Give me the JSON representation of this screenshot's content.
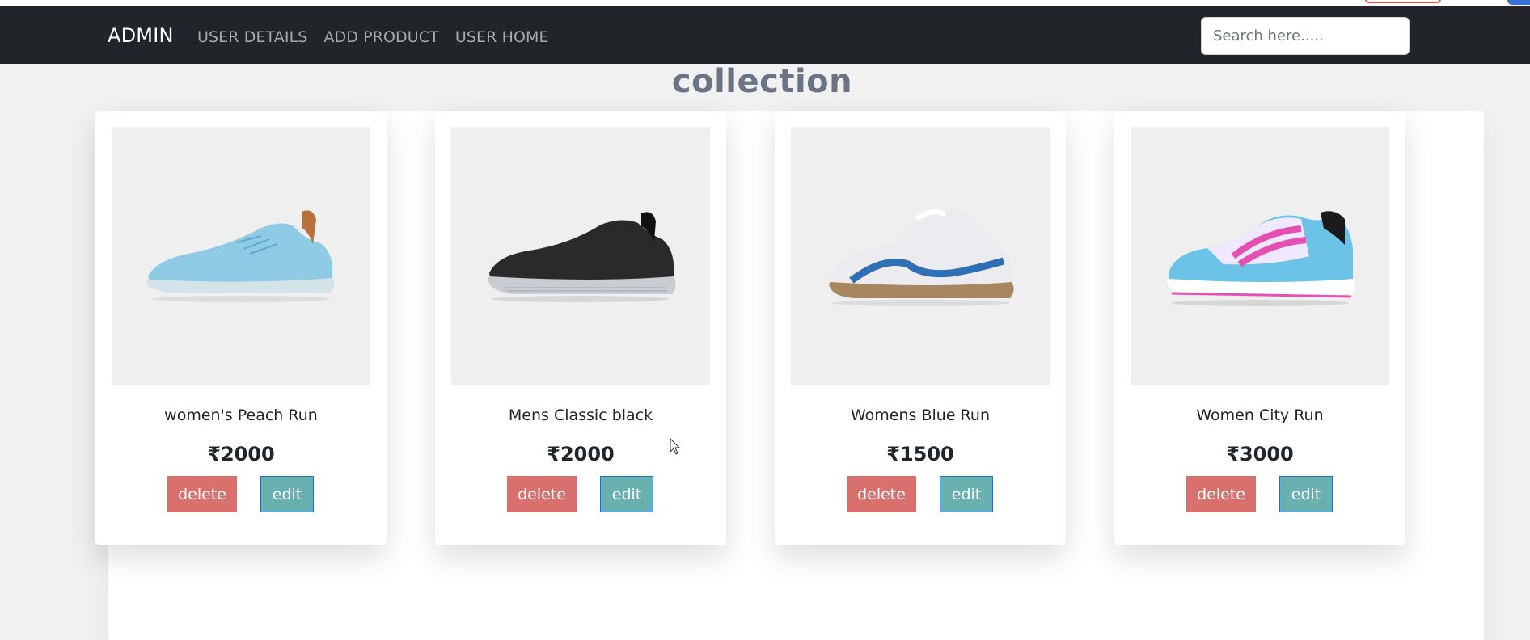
{
  "nav": {
    "brand": "ADMIN",
    "links": [
      "USER DETAILS",
      "ADD PRODUCT",
      "USER HOME"
    ],
    "search_placeholder": "Search here....."
  },
  "page": {
    "heading": "collection"
  },
  "products": [
    {
      "name": "women's Peach Run",
      "price": "₹2000",
      "delete_label": "delete",
      "edit_label": "edit",
      "image_icon": "sneaker-icon",
      "color_main": "#8fcbe4",
      "color_sole": "#d4e3e8",
      "color_accent": "#b5723d"
    },
    {
      "name": "Mens Classic black",
      "price": "₹2000",
      "delete_label": "delete",
      "edit_label": "edit",
      "image_icon": "sneaker-icon",
      "color_main": "#2a2a2a",
      "color_sole": "#c9ccd0",
      "color_accent": "#111111"
    },
    {
      "name": "Womens Blue Run",
      "price": "₹1500",
      "delete_label": "delete",
      "edit_label": "edit",
      "image_icon": "sneaker-icon",
      "color_main": "#ecebf0",
      "color_sole": "#a88760",
      "color_accent": "#2f6fb3"
    },
    {
      "name": "Women City Run",
      "price": "₹3000",
      "delete_label": "delete",
      "edit_label": "edit",
      "image_icon": "sneaker-icon",
      "color_main": "#6cc3e8",
      "color_sole": "#efe8ff",
      "color_accent": "#e64fb2"
    }
  ],
  "colors": {
    "navbar_bg": "#212529",
    "delete_button": "#d9706e",
    "edit_button": "#69b0b0",
    "heading": "#6b7485"
  }
}
